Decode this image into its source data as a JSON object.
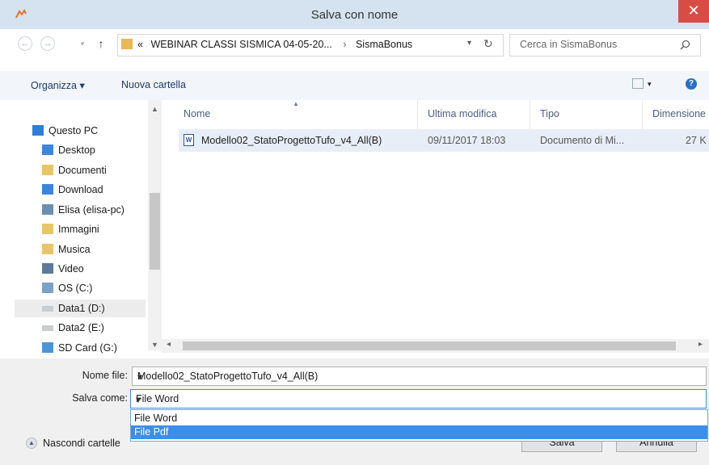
{
  "window": {
    "title": "Salva con nome",
    "close": "✕"
  },
  "address": {
    "path": [
      "«",
      "WEBINAR CLASSI SISMICA 04-05-20...",
      "›",
      "SismaBonus"
    ],
    "search_placeholder": "Cerca in SismaBonus"
  },
  "toolbar": {
    "organize": "Organizza ▾",
    "new_folder": "Nuova cartella"
  },
  "nav": [
    {
      "label": "Questo PC",
      "icon": "computer-icon"
    },
    {
      "label": "Desktop",
      "icon": "desktop-folder-icon"
    },
    {
      "label": "Documenti",
      "icon": "documents-folder-icon"
    },
    {
      "label": "Download",
      "icon": "download-folder-icon"
    },
    {
      "label": "Elisa (elisa-pc)",
      "icon": "network-computer-icon"
    },
    {
      "label": "Immagini",
      "icon": "pictures-folder-icon"
    },
    {
      "label": "Musica",
      "icon": "music-folder-icon"
    },
    {
      "label": "Video",
      "icon": "video-folder-icon"
    },
    {
      "label": "OS (C:)",
      "icon": "system-drive-icon"
    },
    {
      "label": "Data1 (D:)",
      "icon": "drive-icon"
    },
    {
      "label": "Data2 (E:)",
      "icon": "drive-icon"
    },
    {
      "label": "SD Card (G:)",
      "icon": "sd-card-icon"
    }
  ],
  "columns": {
    "name": "Nome",
    "modified": "Ultima modifica",
    "type": "Tipo",
    "size": "Dimensione"
  },
  "files": [
    {
      "name": "Modello02_StatoProgettoTufo_v4_All(B)",
      "modified": "09/11/2017 18:03",
      "type": "Documento di Mi...",
      "size": "27 K"
    }
  ],
  "form": {
    "filename_label": "Nome file:",
    "filename_value": "Modello02_StatoProgettoTufo_v4_All(B)",
    "savetype_label": "Salva come:",
    "savetype_value": "File Word",
    "savetype_options": [
      "File Word",
      "File Pdf"
    ],
    "hide_folders": "Nascondi cartelle",
    "save_button": "Salva",
    "cancel_button": "Annulla"
  },
  "colors": {
    "accent": "#3b8ee9",
    "title_bar": "#d4e3ef",
    "close": "#d94c45"
  }
}
